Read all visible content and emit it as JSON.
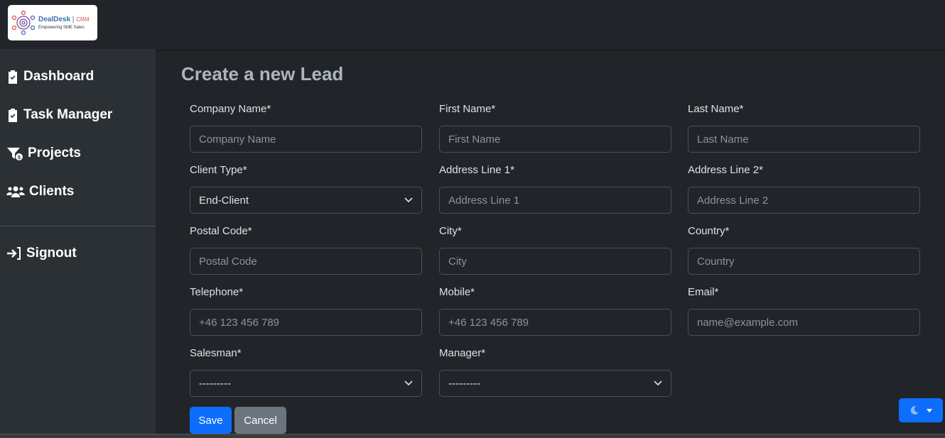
{
  "header": {
    "logo_title": "DealDesk",
    "logo_suffix": "CRM",
    "logo_tagline": "Empowering SME Sales"
  },
  "sidebar": {
    "items": [
      {
        "label": "Dashboard",
        "icon": "clipboard-check-icon"
      },
      {
        "label": "Task Manager",
        "icon": "clipboard-check-icon"
      },
      {
        "label": "Projects",
        "icon": "funnel-dollar-icon"
      },
      {
        "label": "Clients",
        "icon": "users-icon"
      },
      {
        "label": "Signout",
        "icon": "sign-in-icon"
      }
    ]
  },
  "main": {
    "title": "Create a new Lead",
    "fields": [
      {
        "label": "Company Name*",
        "placeholder": "Company Name",
        "type": "input"
      },
      {
        "label": "First Name*",
        "placeholder": "First Name",
        "type": "input"
      },
      {
        "label": "Last Name*",
        "placeholder": "Last Name",
        "type": "input"
      },
      {
        "label": "Client Type*",
        "value": "End-Client",
        "type": "select"
      },
      {
        "label": "Address Line 1*",
        "placeholder": "Address Line 1",
        "type": "input"
      },
      {
        "label": "Address Line 2*",
        "placeholder": "Address Line 2",
        "type": "input"
      },
      {
        "label": "Postal Code*",
        "placeholder": "Postal Code",
        "type": "input"
      },
      {
        "label": "City*",
        "placeholder": "City",
        "type": "input"
      },
      {
        "label": "Country*",
        "placeholder": "Country",
        "type": "input"
      },
      {
        "label": "Telephone*",
        "placeholder": "+46 123 456 789",
        "type": "input"
      },
      {
        "label": "Mobile*",
        "placeholder": "+46 123 456 789",
        "type": "input"
      },
      {
        "label": "Email*",
        "placeholder": "name@example.com",
        "type": "input"
      },
      {
        "label": "Salesman*",
        "value": "---------",
        "type": "select"
      },
      {
        "label": "Manager*",
        "value": "---------",
        "type": "select"
      }
    ],
    "save_label": "Save",
    "cancel_label": "Cancel"
  },
  "colors": {
    "primary": "#0d6efd",
    "secondary": "#6c757d",
    "background": "#212529",
    "sidebar": "#2b3035"
  },
  "theme_toggle": {
    "icon": "moon-icon"
  }
}
